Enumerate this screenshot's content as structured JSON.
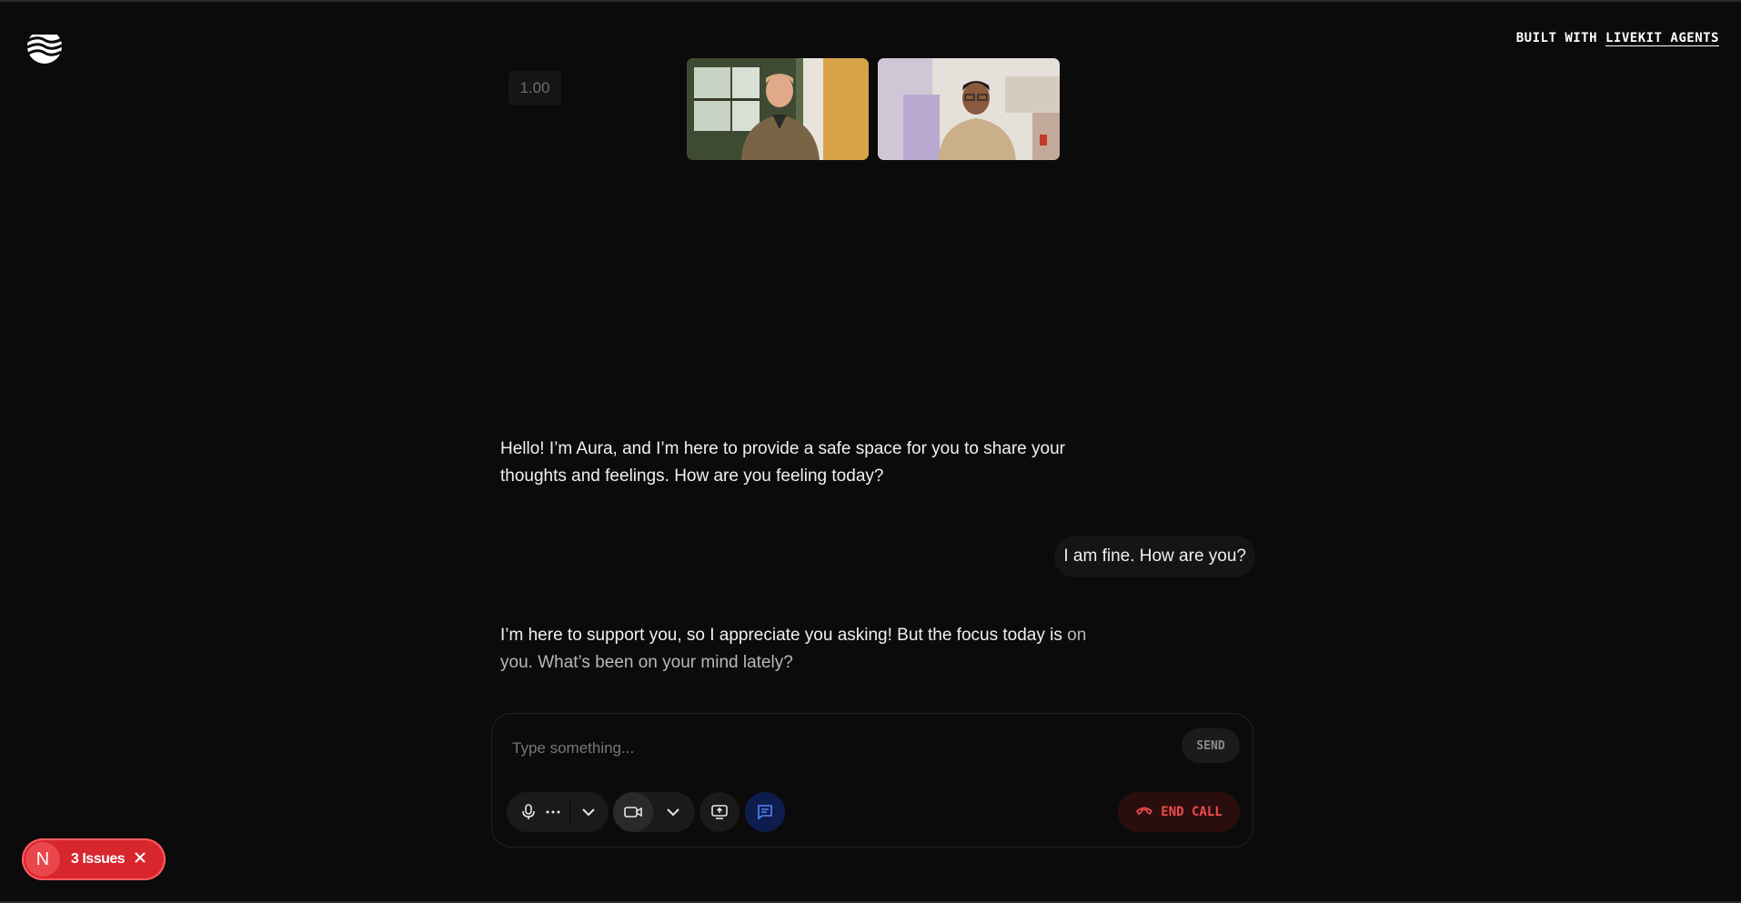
{
  "header": {
    "built_prefix": "BUILT WITH",
    "built_link": "LIVEKIT AGENTS"
  },
  "speed_badge": "1.00",
  "transcript": [
    {
      "role": "agent",
      "text": "Hello! I’m Aura, and I’m here to provide a safe space for you to share your thoughts and feelings. How are you feeling today?"
    },
    {
      "role": "user",
      "text": "I am fine. How are you?"
    },
    {
      "role": "agent",
      "text_bright": "I’m here to support you, so I appreciate you asking! But the focus today is",
      "text_dim": "on you. What’s been on your mind lately?"
    }
  ],
  "composer": {
    "placeholder": "Type something...",
    "send_label": "SEND"
  },
  "controls": {
    "end_call_label": "END CALL",
    "icons": [
      "microphone-icon",
      "more-dots-icon",
      "chevron-down-icon",
      "camera-icon",
      "screen-share-icon",
      "chat-icon",
      "hangup-phone-icon"
    ]
  },
  "issues_badge": {
    "avatar_letter": "N",
    "label": "3 Issues"
  },
  "colors": {
    "background": "#0b0b0c",
    "end_call_red": "#ef4b4b",
    "chat_active": "#0e1d4d",
    "issues_red": "#d8262d"
  }
}
